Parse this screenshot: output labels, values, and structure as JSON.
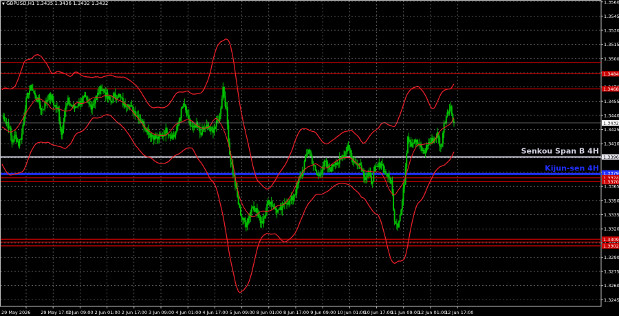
{
  "header": {
    "symbol": "GBPUSD,H1",
    "prices": "1.3435 1.3436 1.3432 1.3432",
    "arrow": "▼"
  },
  "colors": {
    "background": "#000000",
    "grid": "#8a8a8a",
    "candle": "#00c000",
    "ichimoku": "#e8202a",
    "senkou": "#d0d0e0",
    "kijun": "#2030ff",
    "level": "#cc0000"
  },
  "chart_data": {
    "type": "candlestick",
    "title": "GBPUSD,H1",
    "ylim": [
      1.3238,
      1.3562
    ],
    "y_ticks": [
      "1.3560",
      "1.3545",
      "1.3530",
      "1.3515",
      "1.3500",
      "1.3485",
      "1.3470",
      "1.3455",
      "1.3440",
      "1.3425",
      "1.3410",
      "1.3395",
      "1.3380",
      "1.3365",
      "1.3350",
      "1.3335",
      "1.3320",
      "1.3305",
      "1.3290",
      "1.3275",
      "1.3260",
      "1.3245"
    ],
    "x_ticks": [
      "29 May 2026",
      "29 May 17:00",
      "1 Jun 09:00",
      "2 Jun 01:00",
      "2 Jun 17:00",
      "3 Jun 09:00",
      "4 Jun 01:00",
      "4 Jun 17:00",
      "5 Jun 09:00",
      "8 Jun 01:00",
      "8 Jun 17:00",
      "9 Jun 09:00",
      "10 Jun 01:00",
      "10 Jun 17:00",
      "11 Jun 09:00",
      "12 Jun 01:00",
      "12 Jun 17:00"
    ],
    "close_path": [
      1.344,
      1.3435,
      1.343,
      1.3412,
      1.3418,
      1.341,
      1.342,
      1.345,
      1.3465,
      1.347,
      1.346,
      1.3455,
      1.3445,
      1.3452,
      1.346,
      1.3458,
      1.345,
      1.3445,
      1.342,
      1.3445,
      1.3455,
      1.345,
      1.3448,
      1.3452,
      1.3455,
      1.3458,
      1.3452,
      1.345,
      1.3455,
      1.3462,
      1.347,
      1.3465,
      1.3458,
      1.3455,
      1.346,
      1.3462,
      1.3458,
      1.345,
      1.3455,
      1.3448,
      1.3445,
      1.344,
      1.3435,
      1.343,
      1.3425,
      1.342,
      1.3418,
      1.3415,
      1.3418,
      1.342,
      1.3425,
      1.342,
      1.3418,
      1.3425,
      1.344,
      1.3452,
      1.344,
      1.343,
      1.3425,
      1.3428,
      1.3422,
      1.3425,
      1.3428,
      1.3424,
      1.3425,
      1.343,
      1.344,
      1.347,
      1.3445,
      1.34,
      1.338,
      1.336,
      1.334,
      1.333,
      1.3325,
      1.3335,
      1.3345,
      1.334,
      1.333,
      1.3328,
      1.3342,
      1.335,
      1.3345,
      1.334,
      1.3338,
      1.3342,
      1.335,
      1.3348,
      1.3352,
      1.336,
      1.3372,
      1.338,
      1.3395,
      1.3405,
      1.3392,
      1.338,
      1.3375,
      1.3385,
      1.339,
      1.3382,
      1.3385,
      1.3392,
      1.339,
      1.3395,
      1.3402,
      1.341,
      1.3395,
      1.3388,
      1.3392,
      1.3385,
      1.3375,
      1.3378,
      1.337,
      1.3382,
      1.3385,
      1.339,
      1.338,
      1.3375,
      1.337,
      1.333,
      1.3325,
      1.334,
      1.337,
      1.342,
      1.341,
      1.3415,
      1.341,
      1.3405,
      1.34,
      1.341,
      1.3412,
      1.3415,
      1.342,
      1.3405,
      1.343,
      1.3445,
      1.3448,
      1.3432
    ],
    "series": [
      {
        "name": "Senkou Span B 4H",
        "value": 1.3396
      },
      {
        "name": "Kijun-sen 4H",
        "value": 1.3378
      }
    ],
    "levels": [
      1.3496,
      1.3484,
      1.3468,
      1.3374,
      1.337,
      1.3309,
      1.3306,
      1.3302
    ],
    "current_price": 1.3432
  },
  "right_tags": [
    {
      "text": "1.3484",
      "value": 1.3484,
      "bg": "#cc0000",
      "fg": "#ffffff"
    },
    {
      "text": "1.3468",
      "value": 1.3468,
      "bg": "#cc0000",
      "fg": "#ffffff"
    },
    {
      "text": "1.3432",
      "value": 1.3432,
      "bg": "#ffffff",
      "fg": "#000000"
    },
    {
      "text": "1.3396",
      "value": 1.3396,
      "bg": "#e8e8f0",
      "fg": "#000000"
    },
    {
      "text": "1.3379",
      "value": 1.3379,
      "bg": "#2030ff",
      "fg": "#ffffff"
    },
    {
      "text": "1.3374",
      "value": 1.3374,
      "bg": "#cc0000",
      "fg": "#ffffff"
    },
    {
      "text": "1.3370",
      "value": 1.337,
      "bg": "#cc0000",
      "fg": "#ffffff"
    },
    {
      "text": "1.3309",
      "value": 1.3309,
      "bg": "#cc0000",
      "fg": "#ffffff"
    },
    {
      "text": "1.3302",
      "value": 1.3302,
      "bg": "#cc0000",
      "fg": "#ffffff"
    }
  ],
  "line_labels": {
    "senkou": "Senkou Span B 4H",
    "kijun": "Kijun-sen 4H"
  }
}
